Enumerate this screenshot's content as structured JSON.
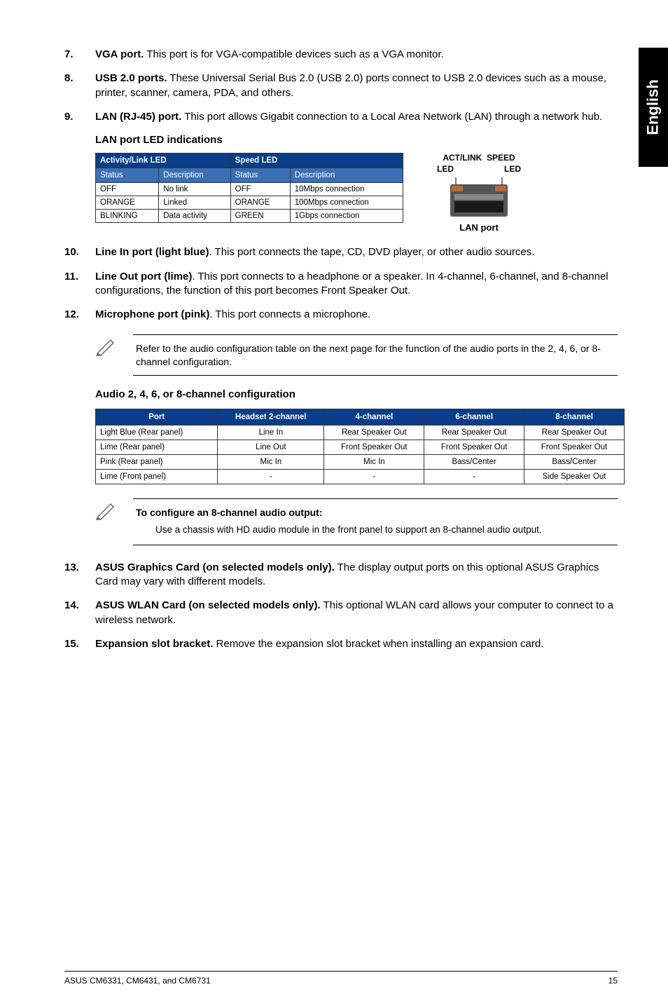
{
  "sideTab": "English",
  "items": {
    "i7": {
      "num": "7.",
      "lead": "VGA port.",
      "rest": " This port is for VGA-compatible devices such as a VGA monitor."
    },
    "i8": {
      "num": "8.",
      "lead": "USB 2.0 ports.",
      "rest": " These Universal Serial Bus 2.0 (USB 2.0) ports connect to USB 2.0 devices such as a mouse, printer, scanner, camera, PDA, and others."
    },
    "i9": {
      "num": "9.",
      "lead": "LAN (RJ-45) port.",
      "rest": " This port allows Gigabit connection to a Local Area Network (LAN) through a network hub."
    },
    "i10": {
      "num": "10.",
      "lead": "Line In port (light blue)",
      "rest": ". This port connects the tape, CD, DVD player, or other audio sources."
    },
    "i11": {
      "num": "11.",
      "lead": "Line Out port (lime)",
      "rest": ". This port connects to a headphone or a speaker. In 4-channel, 6-channel, and 8-channel configurations, the function of this port becomes Front Speaker Out."
    },
    "i12": {
      "num": "12.",
      "lead": "Microphone port (pink)",
      "rest": ". This port connects a microphone."
    },
    "i13": {
      "num": "13.",
      "lead": "ASUS Graphics Card (on selected models only).",
      "rest": " The display output ports on this optional ASUS Graphics Card may vary with different models."
    },
    "i14": {
      "num": "14.",
      "lead": "ASUS WLAN Card (on selected models only).",
      "rest": " This optional WLAN card allows your computer to connect to a wireless network."
    },
    "i15": {
      "num": "15.",
      "lead": "Expansion slot bracket.",
      "rest": " Remove the expansion slot bracket when installing an expansion card."
    }
  },
  "ledTitle": "LAN port LED indications",
  "ledTable": {
    "group1": "Activity/Link LED",
    "group2": "Speed LED",
    "h1": "Status",
    "h2": "Description",
    "h3": "Status",
    "h4": "Description",
    "r1c1": "OFF",
    "r1c2": "No link",
    "r1c3": "OFF",
    "r1c4": "10Mbps connection",
    "r2c1": "ORANGE",
    "r2c2": "Linked",
    "r2c3": "ORANGE",
    "r2c4": "100Mbps connection",
    "r3c1": "BLINKING",
    "r3c2": "Data activity",
    "r3c3": "GREEN",
    "r3c4": "1Gbps connection"
  },
  "lanDiagram": {
    "top1": "ACT/LINK",
    "top2": "SPEED",
    "led1": "LED",
    "led2": "LED",
    "caption": "LAN port"
  },
  "note1": "Refer to the audio configuration table on the next page for the function of the audio ports in the 2, 4, 6, or 8-channel configuration.",
  "audioTitle": "Audio 2, 4, 6, or 8-channel configuration",
  "audioTable": {
    "h1": "Port",
    "h2": "Headset 2-channel",
    "h3": "4-channel",
    "h4": "6-channel",
    "h5": "8-channel",
    "r1": {
      "c1": "Light Blue (Rear panel)",
      "c2": "Line In",
      "c3": "Rear Speaker Out",
      "c4": "Rear Speaker Out",
      "c5": "Rear Speaker Out"
    },
    "r2": {
      "c1": "Lime (Rear panel)",
      "c2": "Line Out",
      "c3": "Front Speaker Out",
      "c4": "Front Speaker Out",
      "c5": "Front Speaker Out"
    },
    "r3": {
      "c1": "Pink (Rear panel)",
      "c2": "Mic In",
      "c3": "Mic In",
      "c4": "Bass/Center",
      "c5": "Bass/Center"
    },
    "r4": {
      "c1": "Lime (Front panel)",
      "c2": "-",
      "c3": "-",
      "c4": "-",
      "c5": "Side Speaker Out"
    }
  },
  "note2": {
    "title": "To configure an 8-channel audio output:",
    "body": "Use a chassis with HD audio module in the front panel to support an 8-channel audio output."
  },
  "footer": {
    "left": "ASUS CM6331, CM6431, and CM6731",
    "right": "15"
  }
}
